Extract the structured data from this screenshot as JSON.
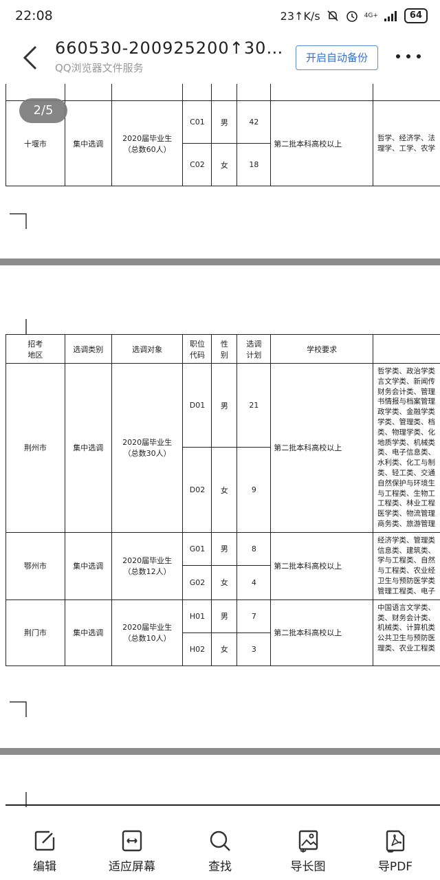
{
  "status_bar": {
    "time": "22:08",
    "speed": "23↑K/s",
    "network": "4G+",
    "battery": "64"
  },
  "title_bar": {
    "title": "660530-200925200↑30…",
    "subtitle": "QQ浏览器文件服务",
    "backup_button": "开启自动备份"
  },
  "page_indicator": "2/5",
  "document": {
    "page1_table": {
      "region": "十堰市",
      "type": "集中选调",
      "target_line1": "2020届毕业生",
      "target_line2": "（总数60人）",
      "rows": [
        {
          "code": "C01",
          "gender": "男",
          "count": "42"
        },
        {
          "code": "C02",
          "gender": "女",
          "count": "18"
        }
      ],
      "school": "第二批本科高校以上",
      "majors": [
        "哲学、经济学、法",
        "理学、工学、农学"
      ]
    },
    "page2_table": {
      "headers": {
        "region_l1": "招考",
        "region_l2": "地区",
        "type": "选调类别",
        "target": "选调对象",
        "code_l1": "职位",
        "code_l2": "代码",
        "gender_l1": "性",
        "gender_l2": "别",
        "plan_l1": "选调",
        "plan_l2": "计划",
        "school": "学校要求"
      },
      "groups": [
        {
          "region": "荆州市",
          "type": "集中选调",
          "target_line1": "2020届毕业生",
          "target_line2": "（总数30人）",
          "rows": [
            {
              "code": "D01",
              "gender": "男",
              "count": "21"
            },
            {
              "code": "D02",
              "gender": "女",
              "count": "9"
            }
          ],
          "school": "第二批本科高校以上",
          "majors": [
            "哲学类、政治学类",
            "言文学类、新闻传",
            "财务会计类、管理",
            "书情报与档案管理",
            "政学类、金融学类",
            "学类、管理类、档",
            "类、物理学类、化",
            "地质学类、机械类",
            "类、电子信息类、",
            "水利类、化工与制",
            "类、轻工类、交通",
            "自然保护与环境生",
            "与工程类、生物工",
            "工程类、林业工程",
            "医学类、物流管理",
            "商务类、旅游管理"
          ]
        },
        {
          "region": "鄂州市",
          "type": "集中选调",
          "target_line1": "2020届毕业生",
          "target_line2": "（总数12人）",
          "rows": [
            {
              "code": "G01",
              "gender": "男",
              "count": "8"
            },
            {
              "code": "G02",
              "gender": "女",
              "count": "4"
            }
          ],
          "school": "第二批本科高校以上",
          "majors": [
            "经济学类、管理类",
            "信息类、建筑类、",
            "学与工程类、自然",
            "与工程类、农业经",
            "卫生与预防医学类",
            "管理工程类、电子"
          ]
        },
        {
          "region": "荆门市",
          "type": "集中选调",
          "target_line1": "2020届毕业生",
          "target_line2": "（总数10人）",
          "rows": [
            {
              "code": "H01",
              "gender": "男",
              "count": "7"
            },
            {
              "code": "H02",
              "gender": "女",
              "count": "3"
            }
          ],
          "school": "第二批本科高校以上",
          "majors": [
            "中国语言文学类、",
            "类、财务会计类、",
            "机械类、计算机类",
            "公共卫生与预防医",
            "理类、农业工程类"
          ]
        }
      ]
    }
  },
  "toolbar": {
    "items": [
      {
        "label": "编辑",
        "icon": "edit-icon"
      },
      {
        "label": "适应屏幕",
        "icon": "fit-screen-icon"
      },
      {
        "label": "查找",
        "icon": "search-icon"
      },
      {
        "label": "导长图",
        "icon": "long-image-icon"
      },
      {
        "label": "导PDF",
        "icon": "pdf-icon"
      }
    ]
  },
  "colors": {
    "accent": "#2f6fd1",
    "page_separator": "#8d8d8d",
    "page_pill": "#7b7b7b"
  }
}
